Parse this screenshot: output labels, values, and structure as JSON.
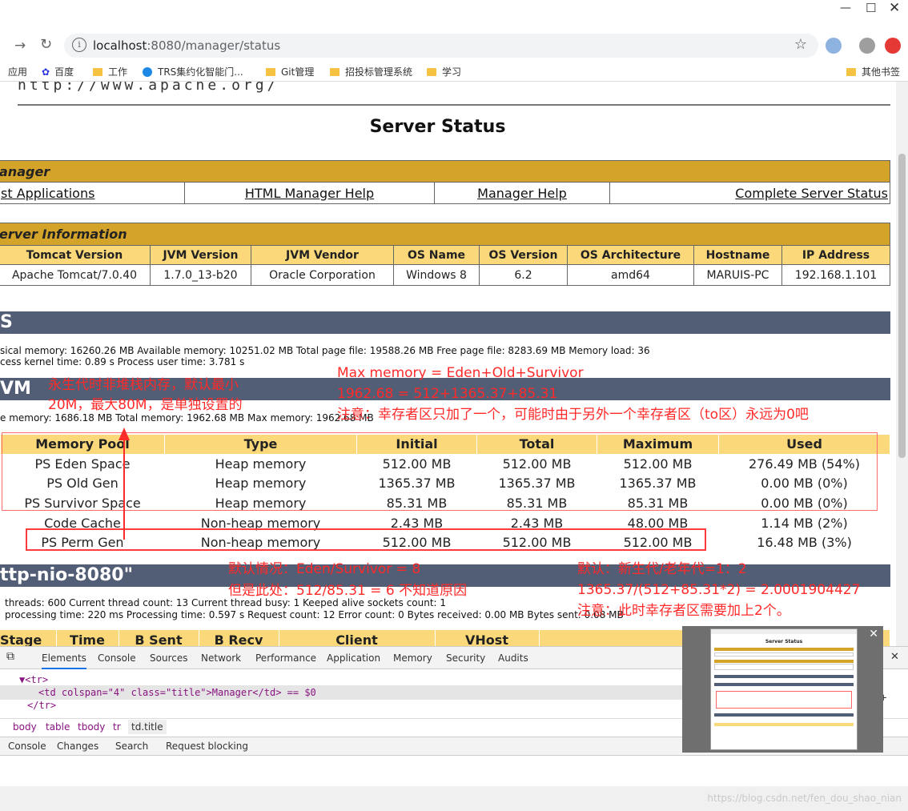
{
  "window": {
    "min_icon": "minimize-icon",
    "max_icon": "maximize-icon",
    "close_icon": "close-icon"
  },
  "browser": {
    "url_host": "localhost",
    "url_rest": ":8080/manager/status",
    "bookmarks": [
      "应用",
      "百度",
      "工作",
      "TRS集约化智能门...",
      "Git管理",
      "招投标管理系统",
      "学习"
    ],
    "other_bookmarks": "其他书签"
  },
  "page": {
    "top_url": "http://www.apache.org/",
    "title": "Server Status",
    "manager": {
      "header": "anager",
      "links": [
        "st Applications",
        "HTML Manager Help",
        "Manager Help",
        "Complete Server Status"
      ]
    },
    "server_info": {
      "header": "erver Information",
      "columns": [
        "Tomcat Version",
        "JVM Version",
        "JVM Vendor",
        "OS Name",
        "OS Version",
        "OS Architecture",
        "Hostname",
        "IP Address"
      ],
      "values": [
        "Apache Tomcat/7.0.40",
        "1.7.0_13-b20",
        "Oracle Corporation",
        "Windows 8",
        "6.2",
        "amd64",
        "MARUIS-PC",
        "192.168.1.101"
      ]
    },
    "os_bar": "S",
    "os_line1": "sical memory: 16260.26 MB Available memory: 10251.02 MB Total page file: 19588.26 MB Free page file: 8283.69 MB Memory load: 36",
    "os_line2": "cess kernel time: 0.89 s Process user time: 3.781 s",
    "jvm_bar": "VM",
    "jvm_line": "e memory: 1686.18 MB Total memory: 1962.68 MB Max memory: 1962.68 MB",
    "memory_pool": {
      "columns": [
        "Memory Pool",
        "Type",
        "Initial",
        "Total",
        "Maximum",
        "Used"
      ],
      "rows": [
        [
          "PS Eden Space",
          "Heap memory",
          "512.00 MB",
          "512.00 MB",
          "512.00 MB",
          "276.49 MB (54%)"
        ],
        [
          "PS Old Gen",
          "Heap memory",
          "1365.37 MB",
          "1365.37 MB",
          "1365.37 MB",
          "0.00 MB (0%)"
        ],
        [
          "PS Survivor Space",
          "Heap memory",
          "85.31 MB",
          "85.31 MB",
          "85.31 MB",
          "0.00 MB (0%)"
        ],
        [
          "Code Cache",
          "Non-heap memory",
          "2.43 MB",
          "2.43 MB",
          "48.00 MB",
          "1.14 MB (2%)"
        ],
        [
          "PS Perm Gen",
          "Non-heap memory",
          "512.00 MB",
          "512.00 MB",
          "512.00 MB",
          "16.48 MB (3%)"
        ]
      ]
    },
    "nio_bar": "ttp-nio-8080\"",
    "nio_line1": "threads: 600 Current thread count: 13 Current thread busy: 1 Keeped alive sockets count: 1",
    "nio_line2": "processing time: 220 ms Processing time: 0.597 s Request count: 12 Error count: 0 Bytes received: 0.00 MB Bytes sent: 0.08 MB",
    "stage_columns": [
      "Stage",
      "Time",
      "B Sent",
      "B Recv",
      "Client",
      "VHost",
      "Re"
    ]
  },
  "annotations": {
    "perm_note": [
      "永生代时非堆栈内存，默认最小",
      "20M，最大80M，是单独设置的"
    ],
    "max_memory": [
      "Max memory = Eden+Old+Survivor",
      "1962.68 = 512+1365.37+85.31",
      "注意：幸存者区只加了一个，可能时由于另外一个幸存者区（to区）永远为0吧"
    ],
    "eden_ratio": [
      "默认情况：Eden/Survivor = 8",
      "但是此处：512/85.31 = 6 不知道原因"
    ],
    "gen_ratio": [
      "默认：新生代/老年代=1：2",
      "1365.37/(512+85.31*2) = 2.0001904427",
      "注意：此时幸存者区需要加上2个。"
    ]
  },
  "devtools": {
    "tabs": [
      "Elements",
      "Console",
      "Sources",
      "Network",
      "Performance",
      "Application",
      "Memory",
      "Security",
      "Audits"
    ],
    "code_lines": [
      "▼<tr>",
      "<td colspan=\"4\" class=\"title\">Manager</td> == $0",
      "</tr>"
    ],
    "breadcrumbs": [
      "body",
      "table",
      "tbody",
      "tr",
      "td.title"
    ],
    "drawer_tabs": [
      "Console",
      "Changes",
      "Search",
      "Request blocking"
    ],
    "side_label": "1s"
  },
  "thumbnail": {
    "title": "Server Status"
  },
  "watermark": "https://blog.csdn.net/fen_dou_shao_nian",
  "colors": {
    "gold": "#d4a42a",
    "header_yellow": "#fbd97a",
    "slate": "#525d76",
    "annotation_red": "#ff2a2a"
  }
}
